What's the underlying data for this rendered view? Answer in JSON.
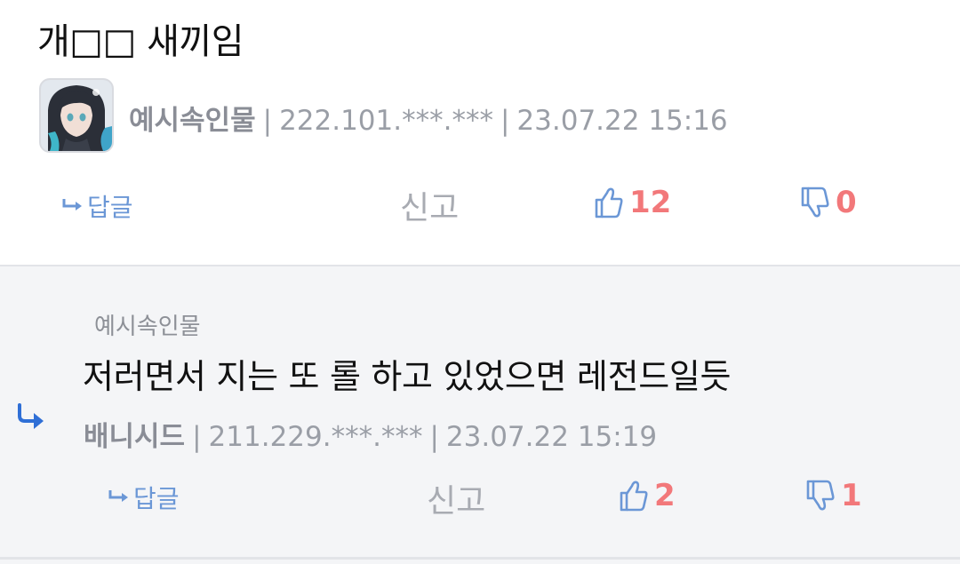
{
  "comment": {
    "text": "개□□ 새끼임",
    "author": "예시속인물",
    "ip": "222.101.***.***",
    "datetime": "23.07.22 15:16",
    "actions": {
      "reply_label": "답글",
      "report_label": "신고",
      "upvotes": "12",
      "downvotes": "0"
    }
  },
  "reply": {
    "reply_to": "예시속인물",
    "text": "저러면서 지는 또 롤 하고 있었으면 레전드일듯",
    "author": "배니시드",
    "ip": "211.229.***.***",
    "datetime": "23.07.22 15:19",
    "actions": {
      "reply_label": "답글",
      "report_label": "신고",
      "upvotes": "2",
      "downvotes": "1"
    }
  },
  "separator": "|",
  "colors": {
    "accent_blue": "#6b97d6",
    "vote_count_red": "#f2787a",
    "reply_bg": "#f4f5f7",
    "reply_arrow": "#2f6fd6"
  },
  "icons": {
    "reply_arrow": "reply-arrow-icon",
    "upvote": "thumbs-up-icon",
    "downvote": "thumbs-down-icon",
    "reply_indicator": "reply-indicator-icon"
  }
}
